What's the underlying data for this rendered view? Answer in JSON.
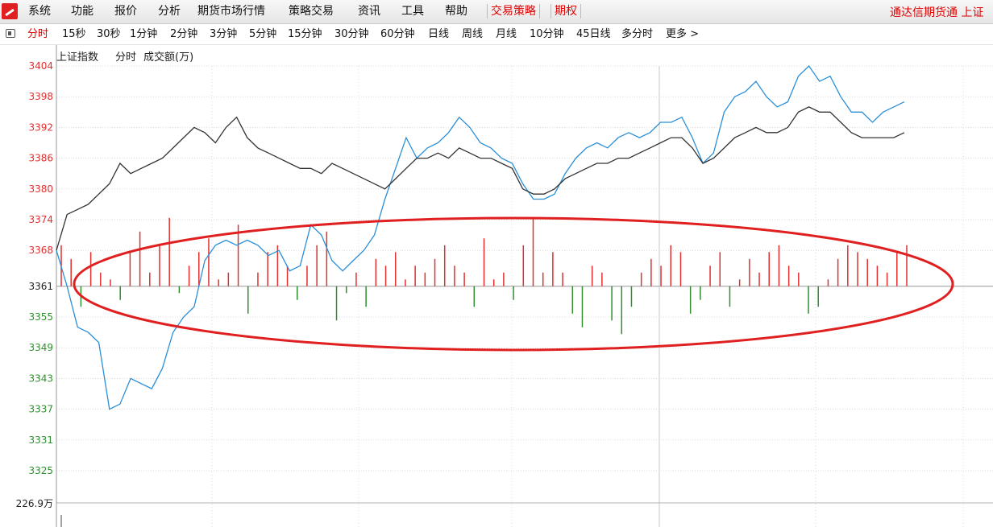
{
  "menu": {
    "items": [
      "系统",
      "功能",
      "报价",
      "分析",
      "期货市场行情",
      "策略交易",
      "资讯",
      "工具",
      "帮助"
    ],
    "strategy_tab": "交易策略",
    "options_tab": "期权",
    "right_text": "通达信期货通  上证"
  },
  "toolbar": {
    "periods": [
      "分时",
      "15秒",
      "30秒",
      "1分钟",
      "2分钟",
      "3分钟",
      "5分钟",
      "15分钟",
      "30分钟",
      "60分钟",
      "日线",
      "周线",
      "月线",
      "10分钟",
      "45日线",
      "多分时",
      "更多 >"
    ],
    "active_index": 0
  },
  "chart_header": {
    "title": "上证指数",
    "mode": "分时",
    "volume_label": "成交额(万)"
  },
  "colors": {
    "accent_red": "#e00000",
    "up_tick": "#e03030",
    "down_tick": "#2f8f2f",
    "price_line": "#2a8fd8",
    "avg_line": "#333333",
    "ellipse": "#e02020"
  },
  "chart_data": {
    "type": "line",
    "title": "上证指数 分时",
    "y_ticks": [
      3404,
      3398,
      3392,
      3386,
      3380,
      3374,
      3368,
      3361,
      3355,
      3349,
      3343,
      3337,
      3331,
      3325
    ],
    "y_baseline": 3361,
    "ylim": [
      3325,
      3404
    ],
    "volume_axis_label": "226.9万",
    "grid": true,
    "series": [
      {
        "values": [
          3368,
          3361,
          3353,
          3352,
          3350,
          3337,
          3338,
          3343,
          3342,
          3341,
          3345,
          3352,
          3355,
          3357,
          3366,
          3369,
          3370,
          3369,
          3370,
          3369,
          3367,
          3368,
          3364,
          3365,
          3373,
          3371,
          3366,
          3364,
          3366,
          3368,
          3371,
          3378,
          3384,
          3390,
          3386,
          3388,
          3389,
          3391,
          3394,
          3392,
          3389,
          3388,
          3386,
          3385,
          3381,
          3378,
          3378,
          3379,
          3383,
          3386,
          3388,
          3389,
          3388,
          3390,
          3391,
          3390,
          3391,
          3393,
          3393,
          3394,
          3390,
          3385,
          3387,
          3395,
          3398,
          3399,
          3401,
          3398,
          3396,
          3397,
          3402,
          3404,
          3401,
          3402,
          3398,
          3395,
          3395,
          3393,
          3395,
          3396,
          3397
        ]
      },
      {
        "values": [
          3368,
          3375,
          3376,
          3377,
          3379,
          3381,
          3385,
          3383,
          3384,
          3385,
          3386,
          3388,
          3390,
          3392,
          3391,
          3389,
          3392,
          3394,
          3390,
          3388,
          3387,
          3386,
          3385,
          3384,
          3384,
          3383,
          3385,
          3384,
          3383,
          3382,
          3381,
          3380,
          3382,
          3384,
          3386,
          3386,
          3387,
          3386,
          3388,
          3387,
          3386,
          3386,
          3385,
          3384,
          3380,
          3379,
          3379,
          3380,
          3382,
          3383,
          3384,
          3385,
          3385,
          3386,
          3386,
          3387,
          3388,
          3389,
          3390,
          3390,
          3388,
          3385,
          3386,
          3388,
          3390,
          3391,
          3392,
          3391,
          3391,
          3392,
          3395,
          3396,
          3395,
          3395,
          3393,
          3391,
          3390,
          3390,
          3390,
          3390,
          3391
        ]
      }
    ],
    "volume_bars": [
      6,
      4,
      -3,
      5,
      2,
      1,
      -2,
      5,
      8,
      2,
      6,
      10,
      -1,
      3,
      5,
      7,
      1,
      2,
      9,
      -4,
      2,
      5,
      6,
      3,
      -2,
      3,
      6,
      8,
      -5,
      -1,
      2,
      -3,
      4,
      3,
      5,
      1,
      3,
      2,
      4,
      6,
      3,
      2,
      -3,
      7,
      1,
      2,
      -2,
      6,
      10,
      2,
      5,
      2,
      -4,
      -6,
      3,
      2,
      -5,
      -7,
      -3,
      2,
      4,
      3,
      6,
      5,
      -4,
      -2,
      3,
      5,
      -3,
      1,
      4,
      2,
      5,
      6,
      3,
      2,
      -4,
      -3,
      1,
      4,
      6,
      5,
      4,
      3,
      2,
      5,
      6
    ]
  }
}
